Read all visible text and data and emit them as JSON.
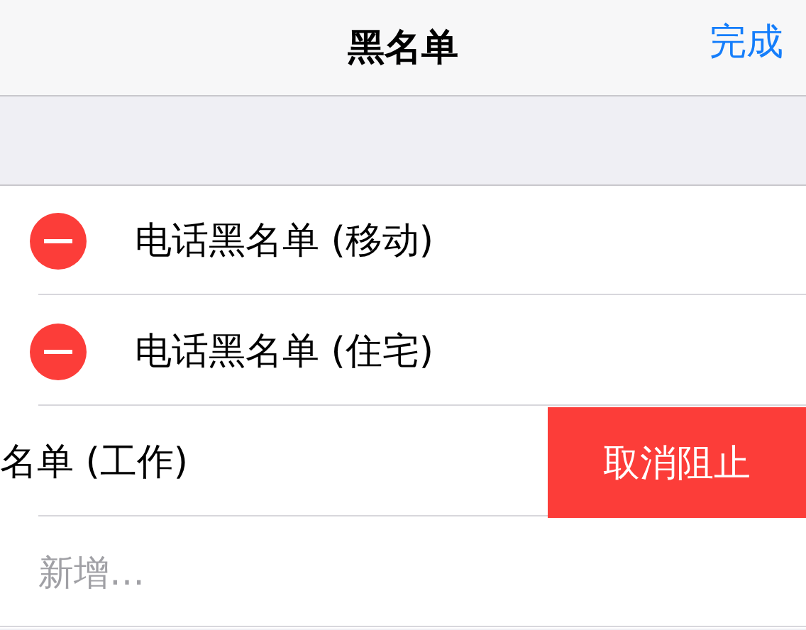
{
  "nav": {
    "title": "黑名单",
    "done": "完成"
  },
  "rows": [
    {
      "kind": "deletable",
      "label": "电话黑名单 (移动)"
    },
    {
      "kind": "deletable",
      "label": "电话黑名单 (住宅)"
    },
    {
      "kind": "swiped",
      "label": "名单 (工作)",
      "action": "取消阻止"
    },
    {
      "kind": "add",
      "label": "新增…"
    }
  ]
}
